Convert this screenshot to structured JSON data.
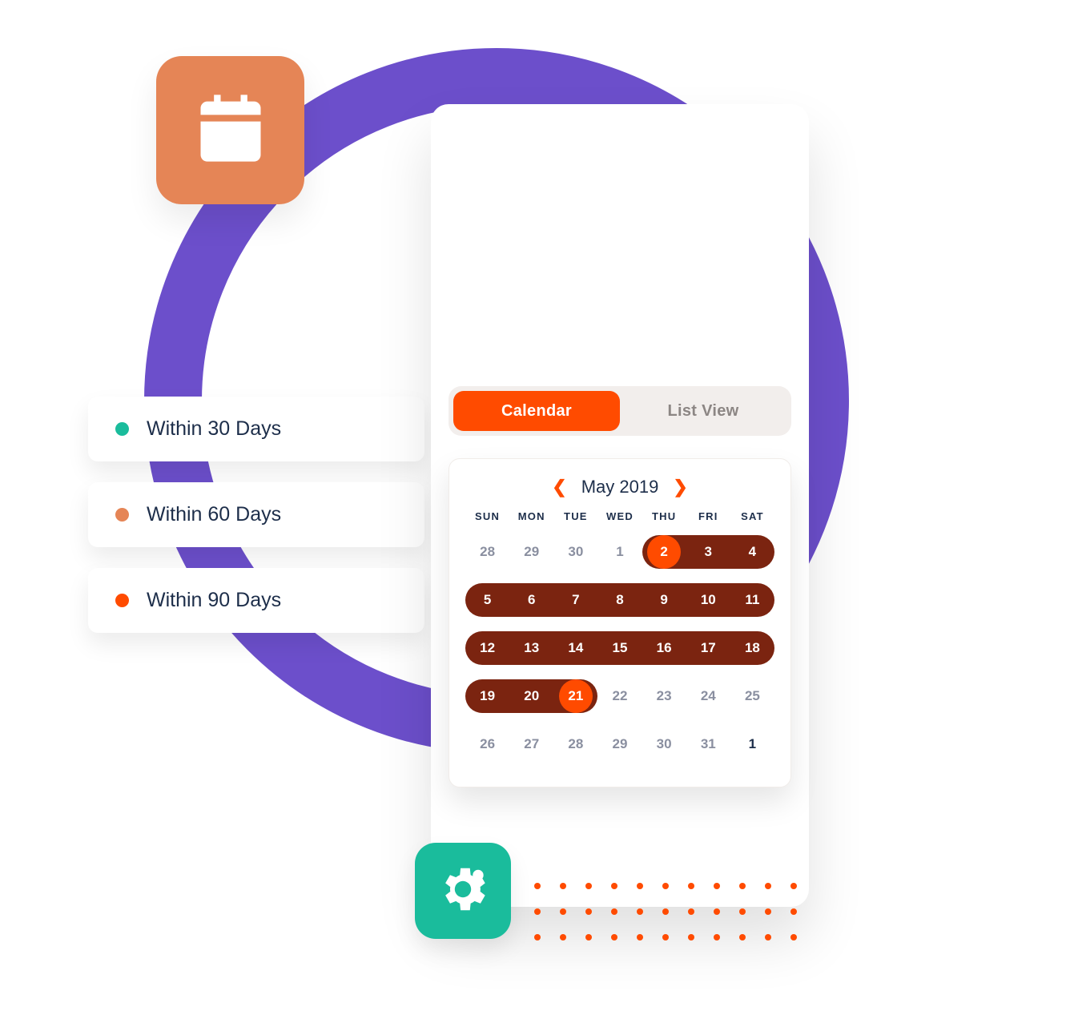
{
  "colors": {
    "purple": "#6C4FCB",
    "orange": "#FF4B00",
    "orange_soft": "#E58556",
    "teal": "#1ABC9C",
    "navy": "#1D2E4A",
    "maroon": "#7B2410"
  },
  "filters": [
    {
      "label": "Within 30 Days",
      "dot": "#1ABC9C"
    },
    {
      "label": "Within 60 Days",
      "dot": "#E58556"
    },
    {
      "label": "Within 90 Days",
      "dot": "#FF4B00"
    }
  ],
  "tabs": {
    "active": "Calendar",
    "inactive": "List View"
  },
  "calendar": {
    "month_label": "May 2019",
    "dow": [
      "SUN",
      "MON",
      "TUE",
      "WED",
      "THU",
      "FRI",
      "SAT"
    ],
    "weeks": [
      [
        {
          "n": "28",
          "out": true
        },
        {
          "n": "29",
          "out": true
        },
        {
          "n": "30",
          "out": true
        },
        {
          "n": "1",
          "out": true
        },
        {
          "n": "2",
          "sel": true,
          "start": true,
          "endpoint": true
        },
        {
          "n": "3",
          "sel": true
        },
        {
          "n": "4",
          "sel": true,
          "end": true
        }
      ],
      [
        {
          "n": "5",
          "sel": true,
          "start": true
        },
        {
          "n": "6",
          "sel": true
        },
        {
          "n": "7",
          "sel": true
        },
        {
          "n": "8",
          "sel": true
        },
        {
          "n": "9",
          "sel": true
        },
        {
          "n": "10",
          "sel": true
        },
        {
          "n": "11",
          "sel": true,
          "end": true
        }
      ],
      [
        {
          "n": "12",
          "sel": true,
          "start": true
        },
        {
          "n": "13",
          "sel": true
        },
        {
          "n": "14",
          "sel": true
        },
        {
          "n": "15",
          "sel": true
        },
        {
          "n": "16",
          "sel": true
        },
        {
          "n": "17",
          "sel": true
        },
        {
          "n": "18",
          "sel": true,
          "end": true
        }
      ],
      [
        {
          "n": "19",
          "sel": true,
          "start": true
        },
        {
          "n": "20",
          "sel": true
        },
        {
          "n": "21",
          "sel": true,
          "end": true,
          "endpoint": true
        },
        {
          "n": "22",
          "out": true
        },
        {
          "n": "23",
          "out": true
        },
        {
          "n": "24",
          "out": true
        },
        {
          "n": "25",
          "out": true
        }
      ],
      [
        {
          "n": "26",
          "out": true
        },
        {
          "n": "27",
          "out": true
        },
        {
          "n": "28",
          "out": true
        },
        {
          "n": "29",
          "out": true
        },
        {
          "n": "30",
          "out": true
        },
        {
          "n": "31",
          "out": true
        },
        {
          "n": "1"
        }
      ]
    ]
  }
}
